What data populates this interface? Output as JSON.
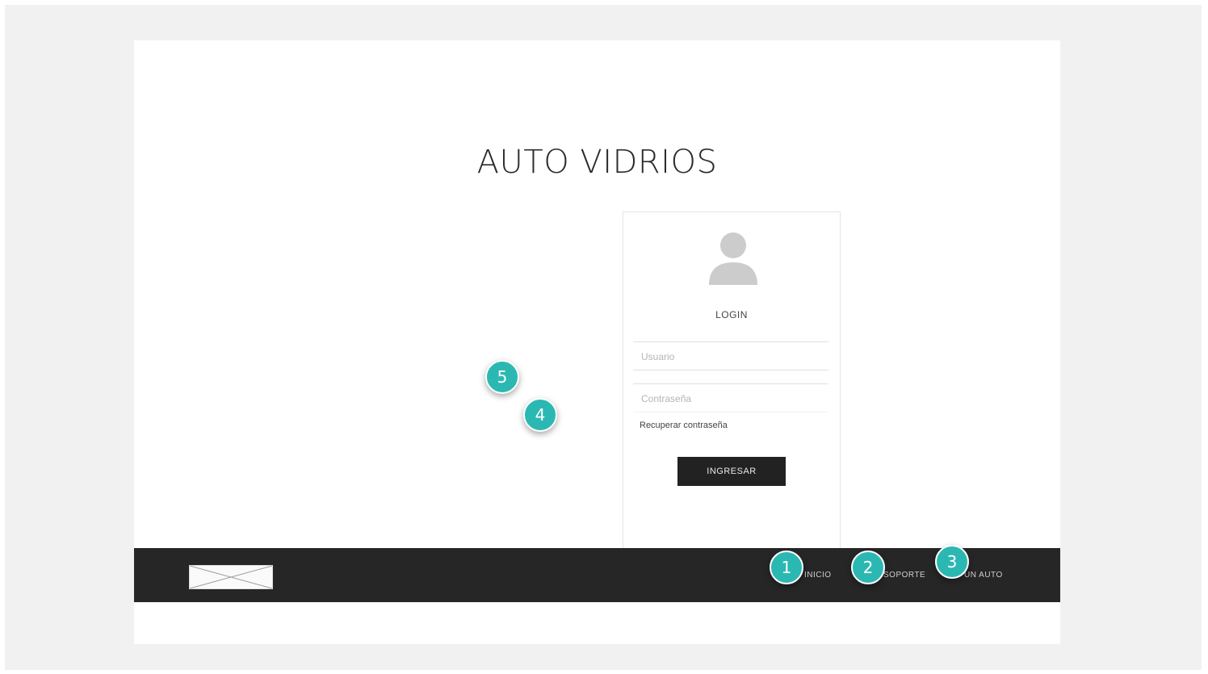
{
  "app": {
    "title": "AUTO VIDRIOS"
  },
  "login": {
    "heading": "LOGIN",
    "username_placeholder": "Usuario",
    "password_placeholder": "Contraseña",
    "remember_label": "Recuperar contraseña",
    "submit_label": "INGRESAR"
  },
  "footer": {
    "links": [
      {
        "label": "INICIO"
      },
      {
        "label": "SOPORTE"
      },
      {
        "label": "UN AUTO"
      }
    ]
  },
  "annotations": [
    {
      "number": "1"
    },
    {
      "number": "2"
    },
    {
      "number": "3"
    },
    {
      "number": "4"
    },
    {
      "number": "5"
    }
  ],
  "colors": {
    "badge": "#2cb8b2",
    "footer_bg": "#262626",
    "button_bg": "#222222"
  }
}
